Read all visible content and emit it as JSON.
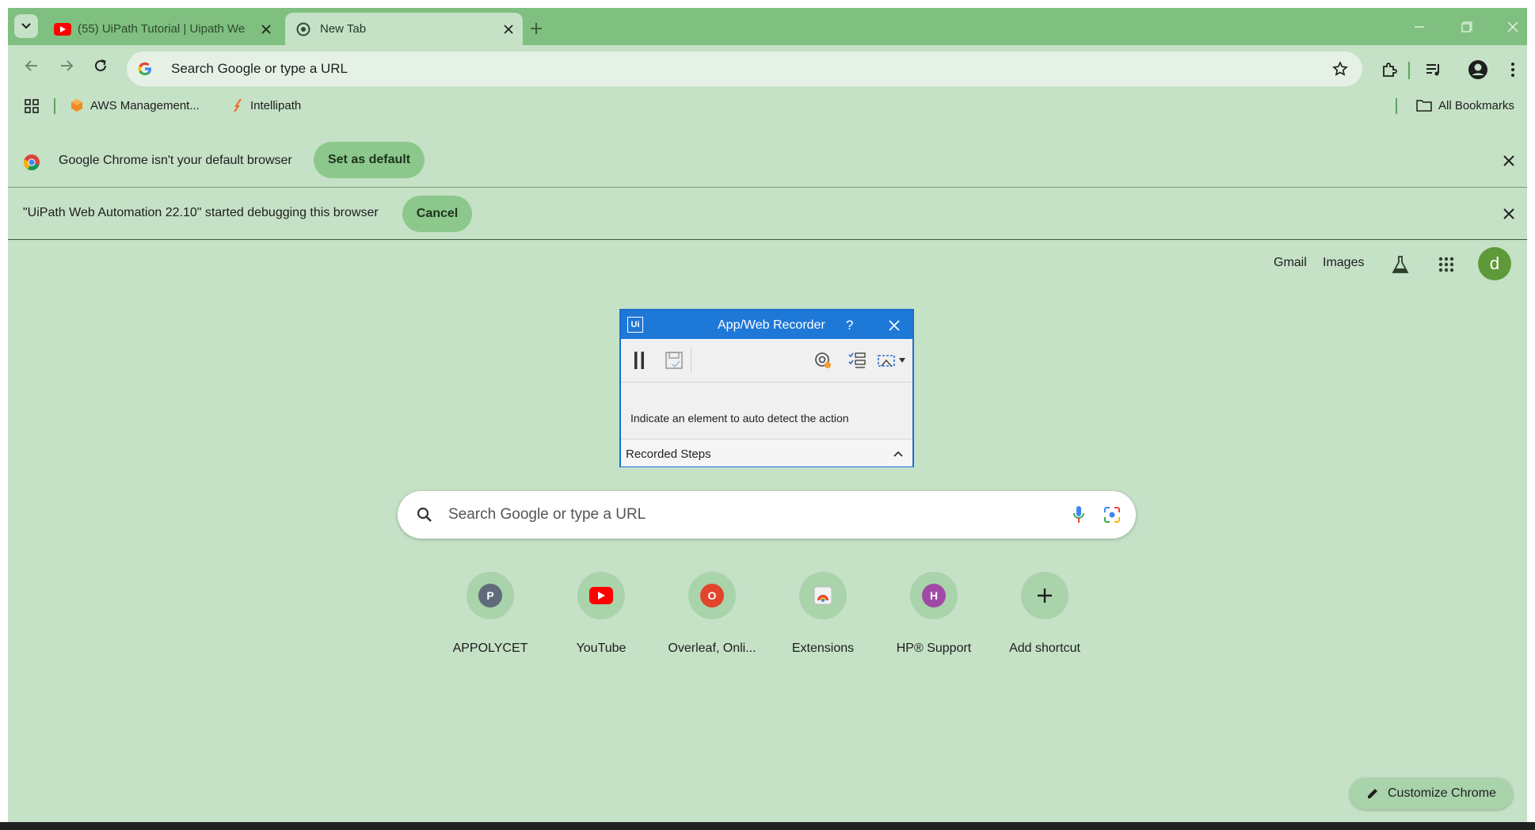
{
  "tabs": [
    {
      "title": "(55) UiPath Tutorial | Uipath We",
      "icon": "youtube-icon",
      "active": false
    },
    {
      "title": "New Tab",
      "icon": "chrome-icon",
      "active": true
    }
  ],
  "omnibox": {
    "placeholder": "Search Google or type a URL"
  },
  "bookmarks": {
    "items": [
      {
        "label": "AWS Management...",
        "icon": "aws-icon"
      },
      {
        "label": "Intellipath",
        "icon": "intellipath-icon"
      }
    ],
    "all_bookmarks": "All Bookmarks"
  },
  "infobar_default": {
    "message": "Google Chrome isn't your default browser",
    "button": "Set as default"
  },
  "infobar_debug": {
    "message": "\"UiPath Web Automation 22.10\" started debugging this browser",
    "button": "Cancel"
  },
  "ntp_header": {
    "gmail": "Gmail",
    "images": "Images",
    "avatar_letter": "d"
  },
  "recorder": {
    "title": "App/Web Recorder",
    "help": "?",
    "logo": "Ui",
    "message": "Indicate an element to auto detect the action",
    "recorded_steps": "Recorded Steps"
  },
  "search": {
    "placeholder": "Search Google or type a URL"
  },
  "shortcuts": [
    {
      "label": "APPOLYCET",
      "letter": "P",
      "color": "#5f6b7a"
    },
    {
      "label": "YouTube",
      "letter": "",
      "color": "#ff0000"
    },
    {
      "label": "Overleaf, Onli...",
      "letter": "O",
      "color": "#e2452b"
    },
    {
      "label": "Extensions",
      "letter": "",
      "color": "#f1f3f4"
    },
    {
      "label": "HP® Support",
      "letter": "H",
      "color": "#a04aa8"
    },
    {
      "label": "Add shortcut",
      "letter": "+",
      "color": "#a9d3ab"
    }
  ],
  "customize": {
    "label": "Customize Chrome"
  },
  "colors": {
    "tabstrip": "#7fbf7f",
    "page_bg": "#c5e1c6",
    "accent": "#8cc88c",
    "recorder_blue": "#1e78d7"
  }
}
